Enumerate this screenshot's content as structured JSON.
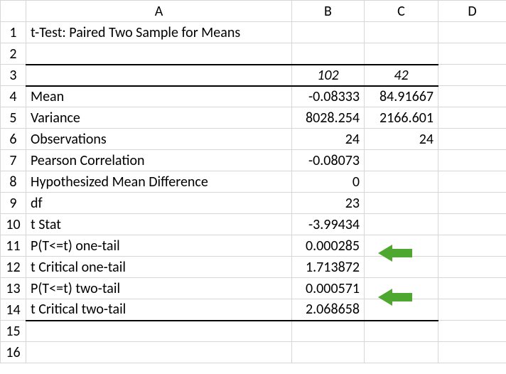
{
  "columns": {
    "A": "A",
    "B": "B",
    "C": "C",
    "D": "D"
  },
  "rowNumbers": [
    "1",
    "2",
    "3",
    "4",
    "5",
    "6",
    "7",
    "8",
    "9",
    "10",
    "11",
    "12",
    "13",
    "14",
    "15",
    "16"
  ],
  "title": "t-Test: Paired Two Sample for Means",
  "headerRow": {
    "B": "102",
    "C": "42"
  },
  "rows": {
    "mean": {
      "label": "Mean",
      "B": "-0.08333",
      "C": "84.91667"
    },
    "variance": {
      "label": "Variance",
      "B": "8028.254",
      "C": "2166.601"
    },
    "obs": {
      "label": "Observations",
      "B": "24",
      "C": "24"
    },
    "pearson": {
      "label": "Pearson Correlation",
      "B": "-0.08073",
      "C": ""
    },
    "hmd": {
      "label": "Hypothesized Mean Difference",
      "B": "0",
      "C": ""
    },
    "df": {
      "label": "df",
      "B": "23",
      "C": ""
    },
    "tstat": {
      "label": "t Stat",
      "B": "-3.99434",
      "C": ""
    },
    "p1": {
      "label": "P(T<=t) one-tail",
      "B": "0.000285",
      "C": ""
    },
    "tcrit1": {
      "label": "t Critical one-tail",
      "B": "1.713872",
      "C": ""
    },
    "p2": {
      "label": "P(T<=t) two-tail",
      "B": "0.000571",
      "C": ""
    },
    "tcrit2": {
      "label": "t Critical two-tail",
      "B": "2.068658",
      "C": ""
    }
  },
  "chart_data": {
    "type": "table",
    "title": "t-Test: Paired Two Sample for Means",
    "variables": [
      102,
      42
    ],
    "statistics": [
      {
        "name": "Mean",
        "v1": -0.08333,
        "v2": 84.91667
      },
      {
        "name": "Variance",
        "v1": 8028.254,
        "v2": 2166.601
      },
      {
        "name": "Observations",
        "v1": 24,
        "v2": 24
      },
      {
        "name": "Pearson Correlation",
        "v1": -0.08073
      },
      {
        "name": "Hypothesized Mean Difference",
        "v1": 0
      },
      {
        "name": "df",
        "v1": 23
      },
      {
        "name": "t Stat",
        "v1": -3.99434
      },
      {
        "name": "P(T<=t) one-tail",
        "v1": 0.000285
      },
      {
        "name": "t Critical one-tail",
        "v1": 1.713872
      },
      {
        "name": "P(T<=t) two-tail",
        "v1": 0.000571
      },
      {
        "name": "t Critical two-tail",
        "v1": 2.068658
      }
    ]
  },
  "arrowColor": "#4EA72E"
}
